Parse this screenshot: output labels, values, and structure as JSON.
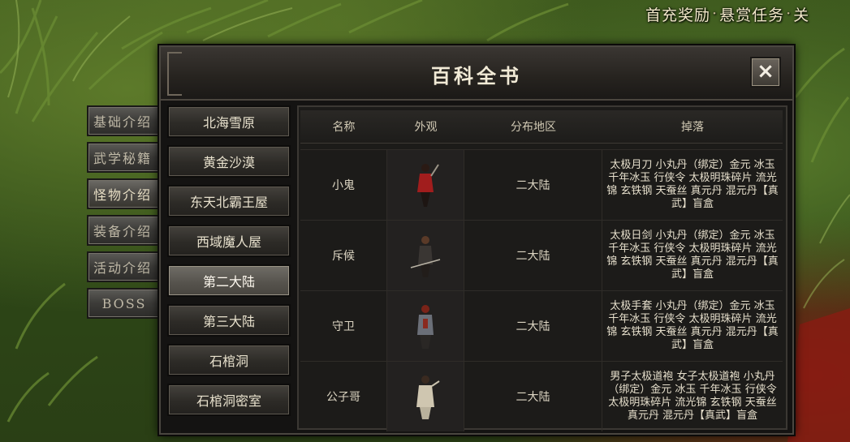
{
  "top_links": [
    "首充奖励",
    "悬赏任务",
    "关"
  ],
  "side_tabs": [
    "基础介绍",
    "武学秘籍",
    "怪物介绍",
    "装备介绍",
    "活动介绍",
    "BOSS"
  ],
  "dialog": {
    "title": "百科全书",
    "close_label": "×"
  },
  "regions": [
    "北海雪原",
    "黄金沙漠",
    "东天北霸王屋",
    "西域魔人屋",
    "第二大陆",
    "第三大陆",
    "石棺洞",
    "石棺洞密室"
  ],
  "selected_region": "第二大陆",
  "table": {
    "headers": [
      "名称",
      "外观",
      "分布地区",
      "掉落"
    ],
    "rows": [
      {
        "name": "小鬼",
        "region": "二大陆",
        "drops": "太极月刀 小丸丹（绑定）金元 冰玉 千年冰玉 行侠令 太极明珠碎片 流光锦 玄铁钢 天蚕丝 真元丹 混元丹【真武】盲盒",
        "sprite_color": "#a11d1d"
      },
      {
        "name": "斥候",
        "region": "二大陆",
        "drops": "太极日剑 小丸丹（绑定）金元 冰玉 千年冰玉 行侠令 太极明珠碎片 流光锦 玄铁钢 天蚕丝 真元丹 混元丹【真武】盲盒",
        "sprite_color": "#3a3633"
      },
      {
        "name": "守卫",
        "region": "二大陆",
        "drops": "太极手套 小丸丹（绑定）金元 冰玉 千年冰玉 行侠令 太极明珠碎片 流光锦 玄铁钢 天蚕丝 真元丹 混元丹【真武】盲盒",
        "sprite_color": "#6b6f78"
      },
      {
        "name": "公子哥",
        "region": "二大陆",
        "drops": "男子太极道袍 女子太极道袍 小丸丹（绑定）金元 冰玉 千年冰玉 行侠令 太极明珠碎片 流光锦 玄铁钢 天蚕丝 真元丹 混元丹【真武】盲盒",
        "sprite_color": "#cfc6b0"
      }
    ]
  }
}
